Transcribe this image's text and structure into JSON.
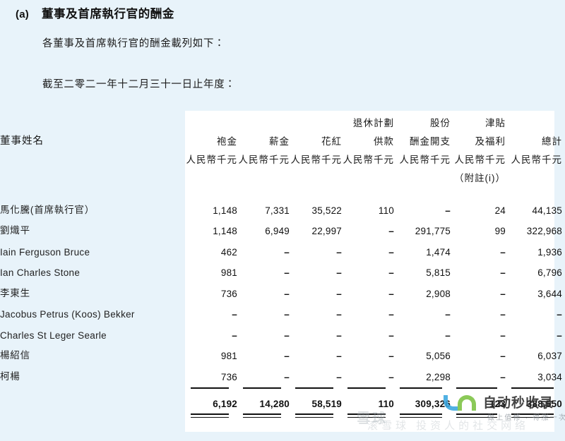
{
  "section": {
    "label": "(a)",
    "title": "董事及首席執行官的酬金",
    "intro": "各董事及首席執行官的酬金載列如下：",
    "period": "截至二零二一年十二月三十一日止年度："
  },
  "table": {
    "name_header": "董事姓名",
    "columns": [
      {
        "top": "",
        "mid": "袍金",
        "unit": "人民幣千元",
        "note": ""
      },
      {
        "top": "",
        "mid": "薪金",
        "unit": "人民幣千元",
        "note": ""
      },
      {
        "top": "",
        "mid": "花紅",
        "unit": "人民幣千元",
        "note": ""
      },
      {
        "top": "退休計劃",
        "mid": "供款",
        "unit": "人民幣千元",
        "note": ""
      },
      {
        "top": "股份",
        "mid": "酬金開支",
        "unit": "人民幣千元",
        "note": ""
      },
      {
        "top": "津貼",
        "mid": "及福利",
        "unit": "人民幣千元",
        "note": "（附註(i)）"
      },
      {
        "top": "",
        "mid": "總計",
        "unit": "人民幣千元",
        "note": ""
      }
    ],
    "rows": [
      {
        "name": "馬化騰(首席執行官）",
        "cjk": true,
        "values": [
          "1,148",
          "7,331",
          "35,522",
          "110",
          "–",
          "24",
          "44,135"
        ]
      },
      {
        "name": "劉熾平",
        "cjk": true,
        "values": [
          "1,148",
          "6,949",
          "22,997",
          "–",
          "291,775",
          "99",
          "322,968"
        ]
      },
      {
        "name": "Iain Ferguson Bruce",
        "cjk": false,
        "values": [
          "462",
          "–",
          "–",
          "–",
          "1,474",
          "–",
          "1,936"
        ]
      },
      {
        "name": "Ian Charles Stone",
        "cjk": false,
        "values": [
          "981",
          "–",
          "–",
          "–",
          "5,815",
          "–",
          "6,796"
        ]
      },
      {
        "name": "李東生",
        "cjk": true,
        "values": [
          "736",
          "–",
          "–",
          "–",
          "2,908",
          "–",
          "3,644"
        ]
      },
      {
        "name": "Jacobus Petrus (Koos) Bekker",
        "cjk": false,
        "values": [
          "–",
          "–",
          "–",
          "–",
          "–",
          "–",
          "–"
        ]
      },
      {
        "name": "Charles St Leger Searle",
        "cjk": false,
        "values": [
          "–",
          "–",
          "–",
          "–",
          "–",
          "–",
          "–"
        ]
      },
      {
        "name": "楊紹信",
        "cjk": true,
        "values": [
          "981",
          "–",
          "–",
          "–",
          "5,056",
          "–",
          "6,037"
        ]
      },
      {
        "name": "柯楊",
        "cjk": true,
        "values": [
          "736",
          "–",
          "–",
          "–",
          "2,298",
          "–",
          "3,034"
        ]
      }
    ],
    "totals": [
      "6,192",
      "14,280",
      "58,519",
      "110",
      "309,326",
      "123",
      "388,550"
    ]
  },
  "watermark": {
    "brand": "自动秒收录",
    "tagline": "做上值修 · 得涨一次 · 领网站副",
    "center_text": "雪球",
    "center_text2": "滚雪球 投资人的社交网络",
    "logo_blue": "#3aa7e0",
    "logo_green": "#7cc242"
  },
  "theme": {
    "page_background": "#e8f3fa",
    "panel_background": "#ffffff",
    "text_color": "#1a1a1a",
    "rule_color": "#111111"
  }
}
